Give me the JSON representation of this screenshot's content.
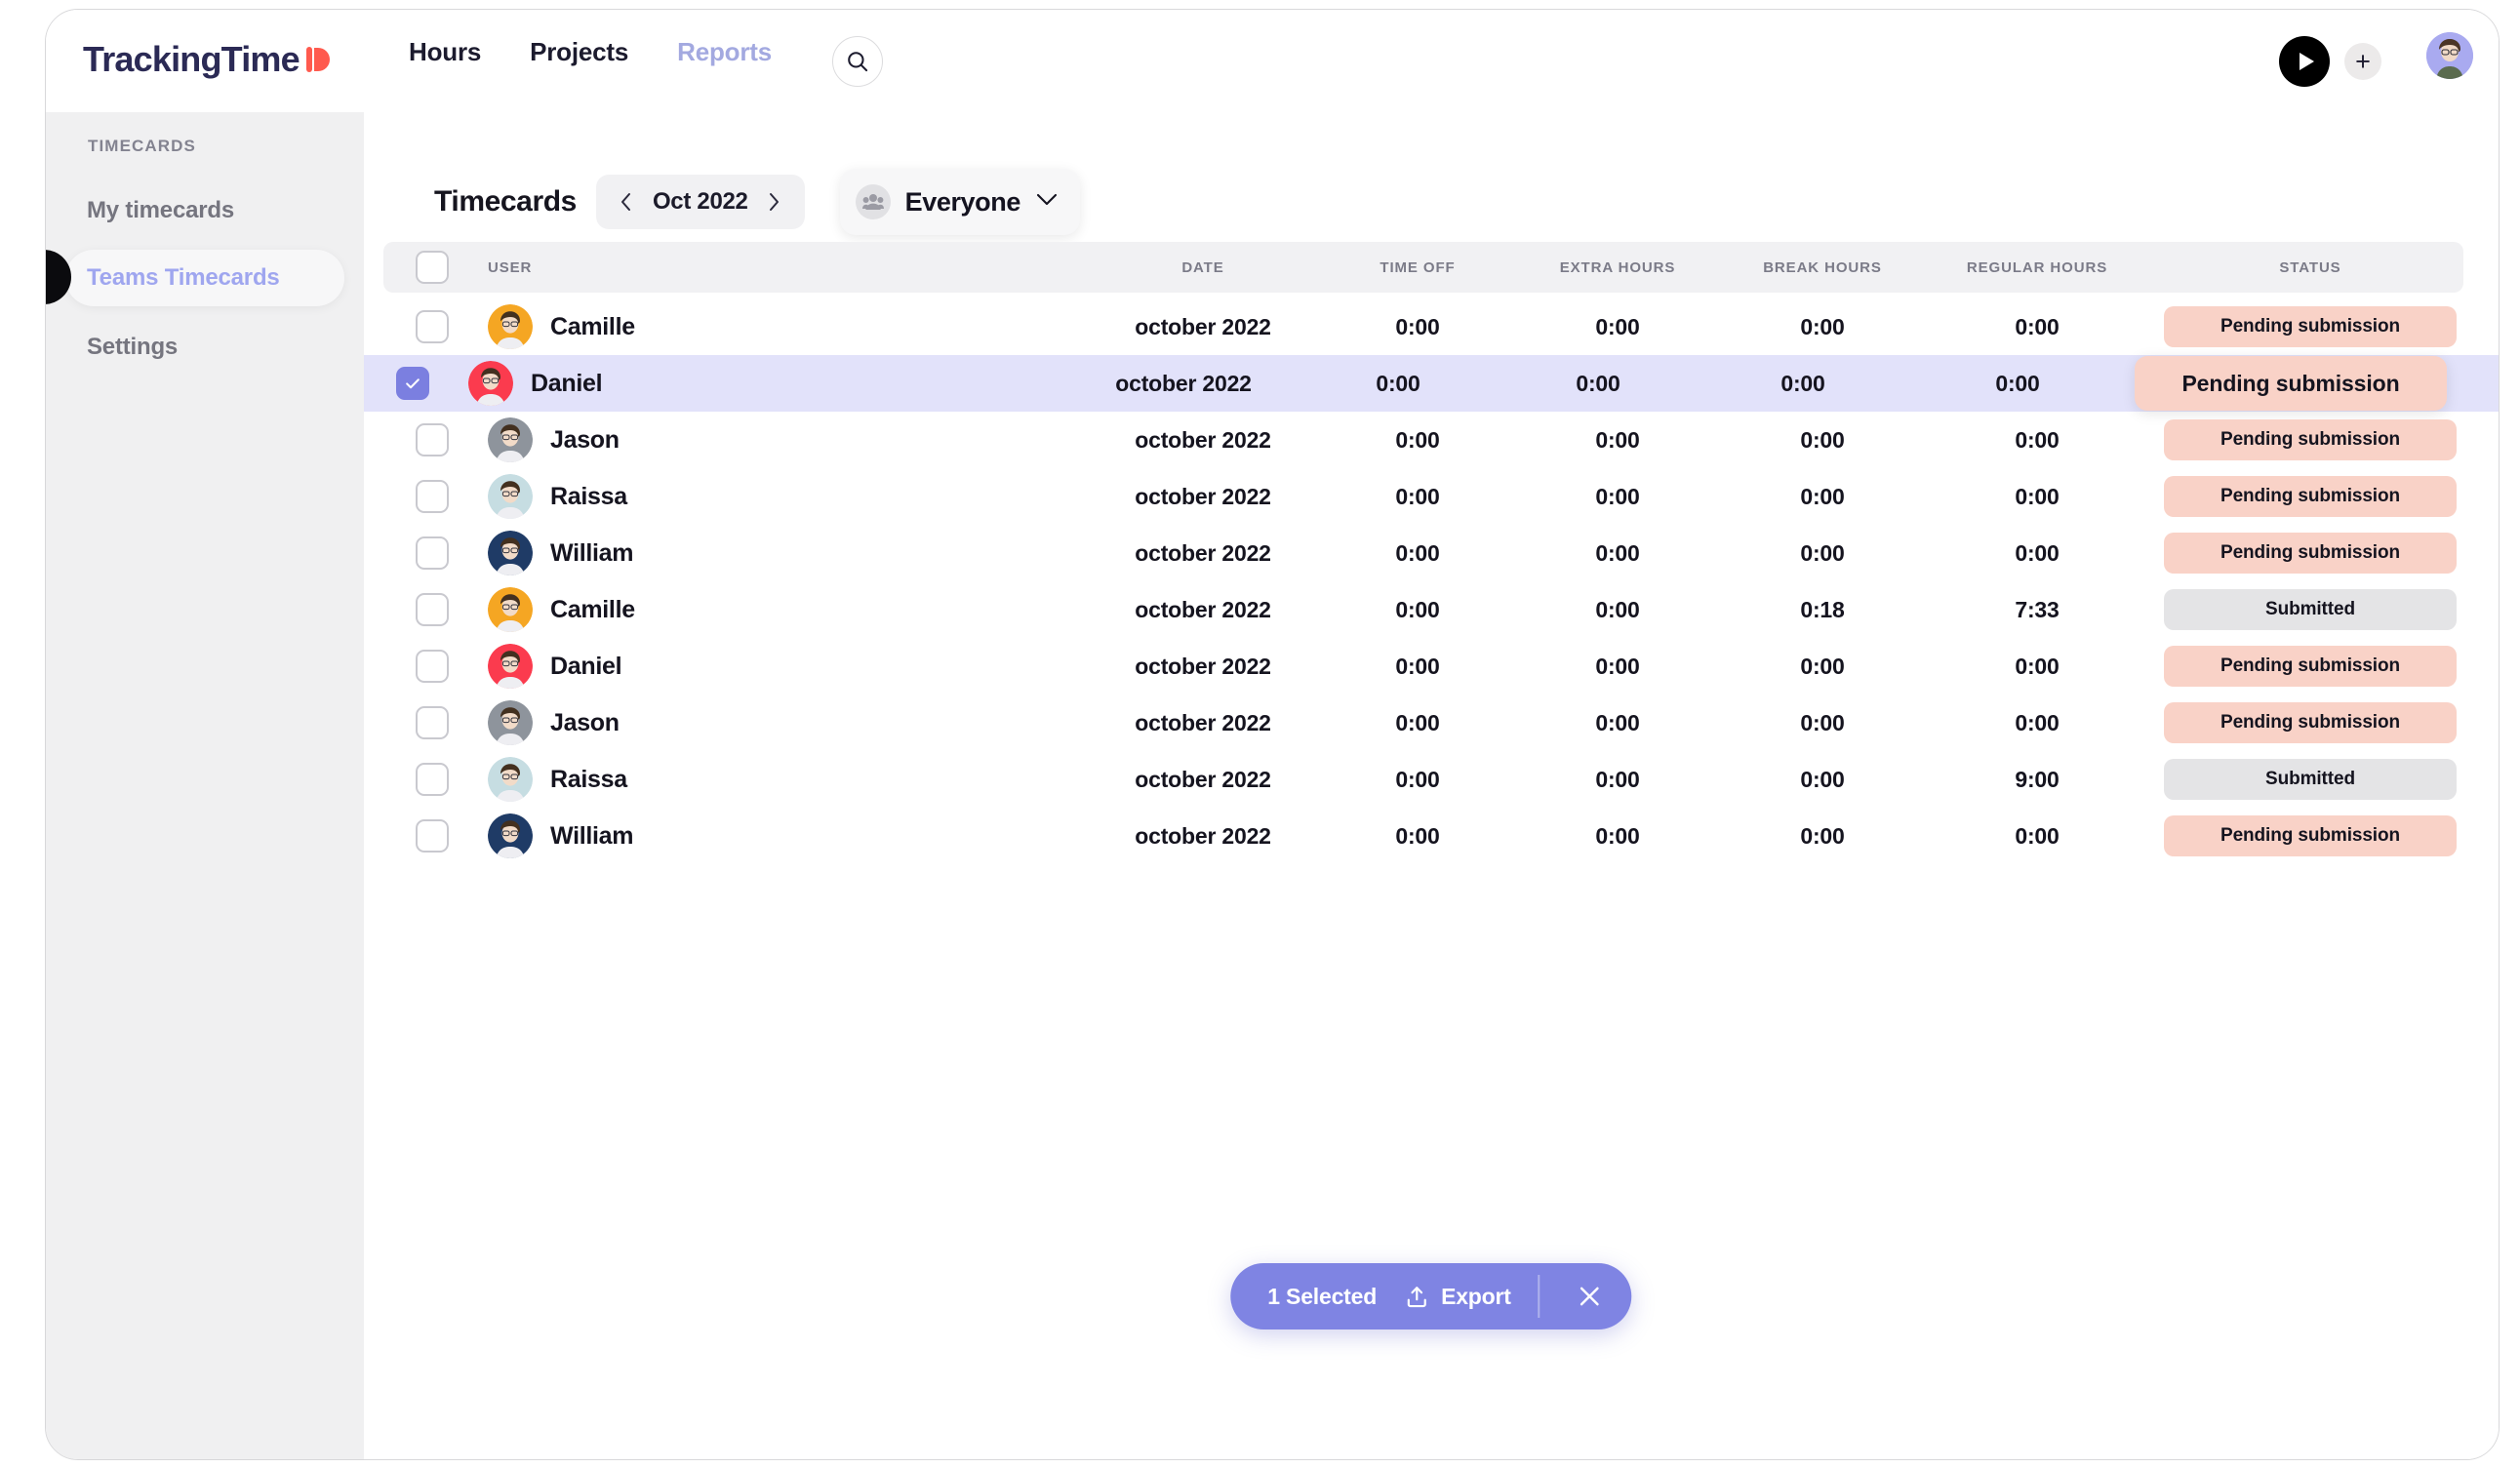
{
  "topnav": {
    "brand": "TrackingTime",
    "brand_accent_color": "#ff5a4e",
    "links": [
      {
        "label": "Hours",
        "active": true
      },
      {
        "label": "Projects",
        "active": true
      },
      {
        "label": "Reports",
        "active": false
      }
    ],
    "search_icon": "search-icon",
    "play_icon": "play-icon",
    "add_icon": "plus-icon",
    "avatar_icon": "user-avatar"
  },
  "sidebar": {
    "section_label": "TIMECARDS",
    "items": [
      {
        "label": "My timecards",
        "active": false
      },
      {
        "label": "Teams Timecards",
        "active": true
      },
      {
        "label": "Settings",
        "active": false
      }
    ],
    "toggle_icon": "sidebar-collapse-icon",
    "active_color": "#9fa6ef"
  },
  "header": {
    "title": "Timecards",
    "period": {
      "prev_icon": "chevron-left-icon",
      "value": "Oct 2022",
      "next_icon": "chevron-right-icon"
    },
    "team_filter": {
      "icon": "people-icon",
      "value": "Everyone",
      "caret_icon": "chevron-down-icon"
    }
  },
  "table": {
    "columns": [
      "USER",
      "DATE",
      "TIME OFF",
      "EXTRA HOURS",
      "BREAK HOURS",
      "REGULAR HOURS",
      "STATUS"
    ],
    "select_all_checked": false,
    "rows": [
      {
        "checked": false,
        "user": "Camille",
        "avatar_color": "#f5a623",
        "date": "october 2022",
        "time_off": "0:00",
        "extra_hours": "0:00",
        "break_hours": "0:00",
        "regular_hours": "0:00",
        "status": "Pending submission",
        "status_type": "pending",
        "selected": false,
        "emphasis": false
      },
      {
        "checked": true,
        "user": "Daniel",
        "avatar_color": "#fb3b4e",
        "date": "october 2022",
        "time_off": "0:00",
        "extra_hours": "0:00",
        "break_hours": "0:00",
        "regular_hours": "0:00",
        "status": "Pending submission",
        "status_type": "pending",
        "selected": true,
        "emphasis": true
      },
      {
        "checked": false,
        "user": "Jason",
        "avatar_color": "#8e949c",
        "date": "october 2022",
        "time_off": "0:00",
        "extra_hours": "0:00",
        "break_hours": "0:00",
        "regular_hours": "0:00",
        "status": "Pending submission",
        "status_type": "pending",
        "selected": false,
        "emphasis": false
      },
      {
        "checked": false,
        "user": "Raissa",
        "avatar_color": "#c6dde2",
        "date": "october 2022",
        "time_off": "0:00",
        "extra_hours": "0:00",
        "break_hours": "0:00",
        "regular_hours": "0:00",
        "status": "Pending submission",
        "status_type": "pending",
        "selected": false,
        "emphasis": false
      },
      {
        "checked": false,
        "user": "William",
        "avatar_color": "#1f3b66",
        "date": "october 2022",
        "time_off": "0:00",
        "extra_hours": "0:00",
        "break_hours": "0:00",
        "regular_hours": "0:00",
        "status": "Pending submission",
        "status_type": "pending",
        "selected": false,
        "emphasis": false
      },
      {
        "checked": false,
        "user": "Camille",
        "avatar_color": "#f5a623",
        "date": "october 2022",
        "time_off": "0:00",
        "extra_hours": "0:00",
        "break_hours": "0:18",
        "regular_hours": "7:33",
        "status": "Submitted",
        "status_type": "submitted",
        "selected": false,
        "emphasis": false
      },
      {
        "checked": false,
        "user": "Daniel",
        "avatar_color": "#fb3b4e",
        "date": "october 2022",
        "time_off": "0:00",
        "extra_hours": "0:00",
        "break_hours": "0:00",
        "regular_hours": "0:00",
        "status": "Pending submission",
        "status_type": "pending",
        "selected": false,
        "emphasis": false
      },
      {
        "checked": false,
        "user": "Jason",
        "avatar_color": "#8e949c",
        "date": "october 2022",
        "time_off": "0:00",
        "extra_hours": "0:00",
        "break_hours": "0:00",
        "regular_hours": "0:00",
        "status": "Pending submission",
        "status_type": "pending",
        "selected": false,
        "emphasis": false
      },
      {
        "checked": false,
        "user": "Raissa",
        "avatar_color": "#c6dde2",
        "date": "october 2022",
        "time_off": "0:00",
        "extra_hours": "0:00",
        "break_hours": "0:00",
        "regular_hours": "9:00",
        "status": "Submitted",
        "status_type": "submitted",
        "selected": false,
        "emphasis": false
      },
      {
        "checked": false,
        "user": "William",
        "avatar_color": "#1f3b66",
        "date": "october 2022",
        "time_off": "0:00",
        "extra_hours": "0:00",
        "break_hours": "0:00",
        "regular_hours": "0:00",
        "status": "Pending submission",
        "status_type": "pending",
        "selected": false,
        "emphasis": false
      }
    ]
  },
  "action_bar": {
    "count_label": "1 Selected",
    "export_label": "Export",
    "export_icon": "upload-icon",
    "close_icon": "close-icon",
    "background_color": "#7f84e3"
  },
  "colors": {
    "selected_row": "#e2e2fa",
    "pending_badge": "#f9d2c7",
    "submitted_badge": "#e4e4e6",
    "checkbox_checked": "#7b7fe0",
    "sidebar_bg": "#f0f0f1"
  }
}
